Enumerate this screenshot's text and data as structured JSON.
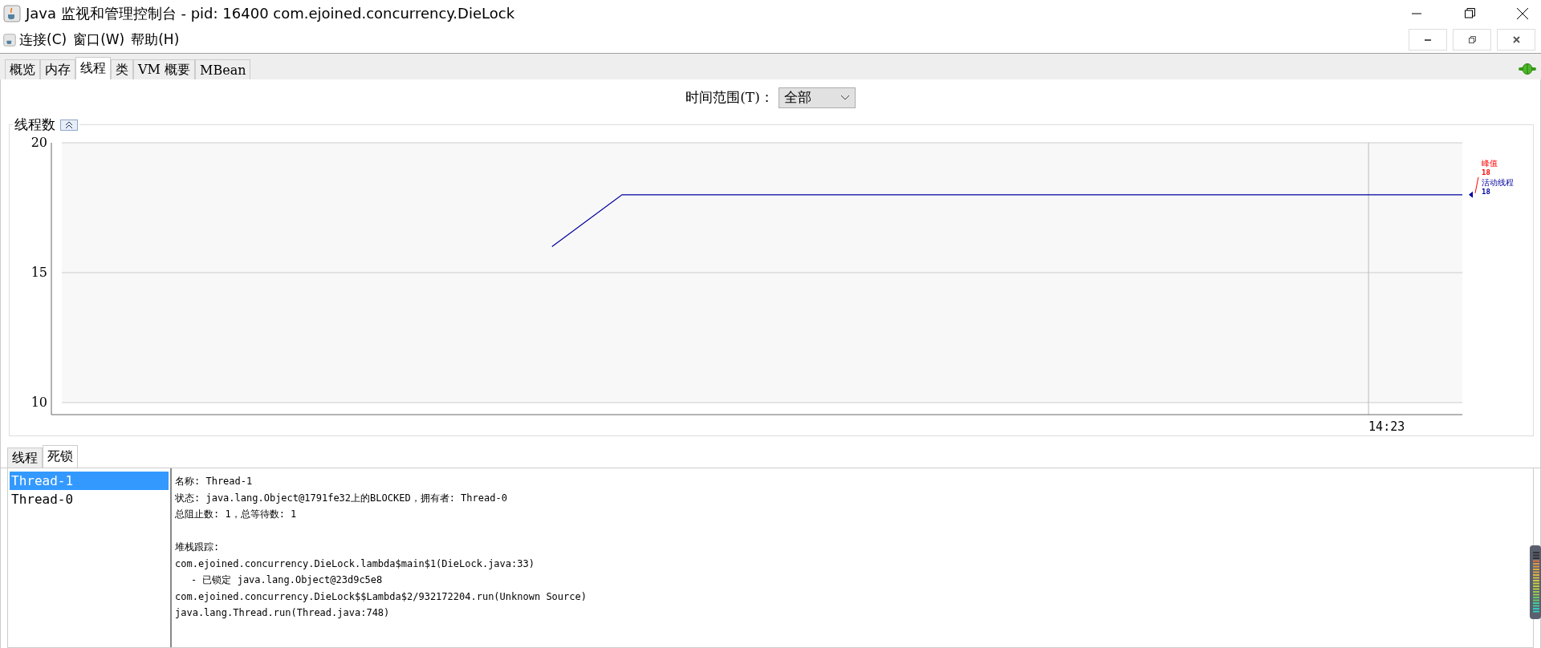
{
  "window": {
    "title": "Java 监视和管理控制台 - pid: 16400 com.ejoined.concurrency.DieLock"
  },
  "menu": [
    {
      "label": "连接(C)"
    },
    {
      "label": "窗口(W)"
    },
    {
      "label": "帮助(H)"
    }
  ],
  "tabs": [
    {
      "label": "概览",
      "selected": false
    },
    {
      "label": "内存",
      "selected": false
    },
    {
      "label": "线程",
      "selected": true
    },
    {
      "label": "类",
      "selected": false
    },
    {
      "label": "VM 概要",
      "selected": false
    },
    {
      "label": "MBean",
      "selected": false
    }
  ],
  "time_range": {
    "label": "时间范围(T)：",
    "value": "全部"
  },
  "thread_chart": {
    "title": "线程数",
    "peak": {
      "label": "峰值",
      "value": "18"
    },
    "current_value": "18",
    "chart_data": {
      "type": "line",
      "ylim": [
        10,
        20
      ],
      "yticks": [
        {
          "value": 10,
          "label": "10"
        },
        {
          "value": 15,
          "label": "15"
        },
        {
          "value": 20,
          "label": "20"
        }
      ],
      "annotations": [
        {
          "text": "14:23"
        }
      ],
      "series": [
        {
          "name": "活动线程",
          "color": "#0000a0",
          "values": [
            null,
            null,
            null,
            null,
            null,
            null,
            null,
            16,
            18,
            18,
            18,
            18,
            18,
            18,
            18,
            18,
            18,
            18,
            18,
            18,
            18
          ]
        }
      ]
    }
  },
  "lower_tabs": [
    {
      "label": "线程",
      "selected": false
    },
    {
      "label": "死锁",
      "selected": true
    }
  ],
  "threads": [
    {
      "name": "Thread-1",
      "selected": true
    },
    {
      "name": "Thread-0",
      "selected": false
    }
  ],
  "details": [
    {
      "kind": "line",
      "text": "名称: Thread-1"
    },
    {
      "kind": "line",
      "text": "状态: java.lang.Object@1791fe32上的BLOCKED，拥有者: Thread-0"
    },
    {
      "kind": "line",
      "text": "总阻止数: 1，总等待数: 1"
    },
    {
      "kind": "gap"
    },
    {
      "kind": "line",
      "text": "堆栈跟踪:"
    },
    {
      "kind": "line",
      "text": "com.ejoined.concurrency.DieLock.lambda$main$1(DieLock.java:33)"
    },
    {
      "kind": "indented",
      "text": "- 已锁定 java.lang.Object@23d9c5e8"
    },
    {
      "kind": "line",
      "text": "com.ejoined.concurrency.DieLock$$Lambda$2/932172204.run(Unknown Source)"
    },
    {
      "kind": "line",
      "text": "java.lang.Thread.run(Thread.java:748)"
    }
  ]
}
